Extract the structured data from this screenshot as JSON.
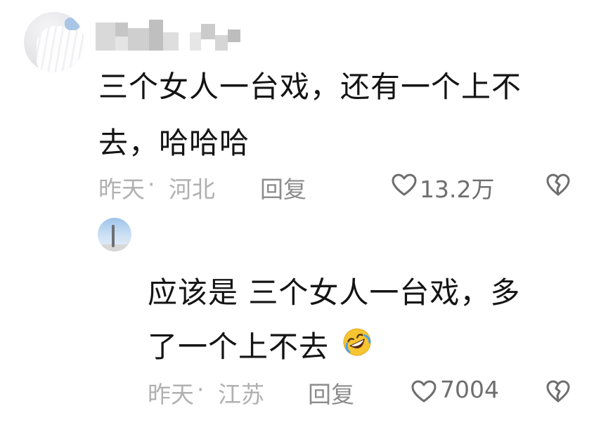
{
  "comments": [
    {
      "avatar_icon": "user-avatar-icon",
      "text_lines": [
        "三个女人一台戏，还有一个上不",
        "去，哈哈哈"
      ],
      "time": "昨天",
      "separator": "·",
      "location": "河北",
      "reply_label": "回复",
      "likes": "13.2万"
    },
    {
      "avatar_icon": "user-avatar-icon",
      "text_lines": [
        "应该是 三个女人一台戏，多",
        "了一个上不去"
      ],
      "emoji": "rolling-on-floor-laughing-emoji",
      "time": "昨天",
      "separator": "·",
      "location": "江苏",
      "reply_label": "回复",
      "likes": "7004"
    }
  ],
  "colors": {
    "text": "#141414",
    "meta": "#b0b0b0",
    "reply": "#8c8c8c",
    "icon": "#6e6e6e",
    "emoji": "#f7c531"
  }
}
